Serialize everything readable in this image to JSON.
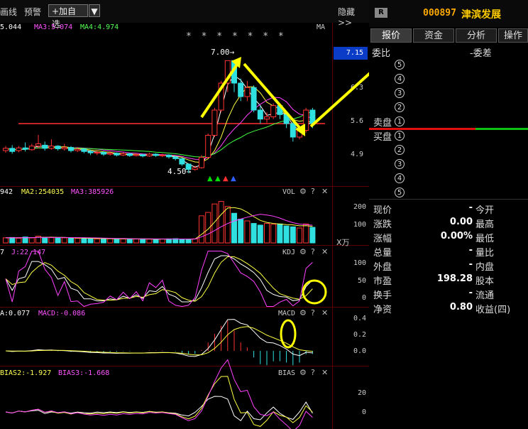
{
  "toolbar": {
    "chart_tab": "画线",
    "alert_tab": "预警",
    "add_favorite": "+加自选",
    "hide_label": "隐藏>>"
  },
  "main": {
    "ma_labels": [
      "5.044",
      "MA3:5.074",
      "MA4:4.974"
    ],
    "ma_tag": "MA",
    "price_ticks": [
      "7.15",
      "6.3",
      "5.6",
      "4.9"
    ],
    "high_label": "7.00→",
    "low_label": "4.50→",
    "stars": "* *  * * *    * *"
  },
  "vol": {
    "labels": [
      "942",
      "MA2:254035",
      "MA3:385926"
    ],
    "name": "VOL",
    "ticks": [
      "200",
      "100"
    ],
    "unit": "X万"
  },
  "kdj": {
    "labels": [
      "7",
      "J:22.147"
    ],
    "name": "KDJ",
    "ticks": [
      "100",
      "50",
      "0"
    ]
  },
  "macd": {
    "labels": [
      "A:0.077",
      "MACD:-0.086"
    ],
    "name": "MACD",
    "ticks": [
      "0.4",
      "0.2",
      "0.0"
    ]
  },
  "bias": {
    "labels": [
      "BIAS2:-1.927",
      "BIAS3:-1.668"
    ],
    "name": "BIAS",
    "ticks": [
      "20",
      "0"
    ]
  },
  "panel": {
    "badge": "R",
    "code": "000897",
    "name": "津滨发展",
    "tabs": [
      "报价",
      "资金",
      "分析",
      "操作"
    ],
    "bid_ratio": "委比",
    "bid_diff": "-委差",
    "sell_label": "卖盘",
    "buy_label": "买盘",
    "levels": [
      "5",
      "4",
      "3",
      "2",
      "1"
    ],
    "buy_levels": [
      "1",
      "2",
      "3",
      "4",
      "5"
    ],
    "stats": [
      {
        "l1": "现价",
        "v1": "-",
        "l2": "今开"
      },
      {
        "l1": "涨跌",
        "v1": "0.00",
        "l2": "最高"
      },
      {
        "l1": "涨幅",
        "v1": "0.00%",
        "l2": "最低"
      },
      {
        "l1": "总量",
        "v1": "-",
        "l2": "量比"
      },
      {
        "l1": "外盘",
        "v1": "-",
        "l2": "内盘"
      },
      {
        "l1": "市盈",
        "v1": "198.28",
        "l2": "股本"
      },
      {
        "l1": "换手",
        "v1": "-",
        "l2": "流通"
      },
      {
        "l1": "净资",
        "v1": "0.80",
        "l2": "收益(四)"
      }
    ]
  },
  "chart_data": {
    "type": "line",
    "title": "",
    "candles": [
      [
        5.0,
        5.05,
        5.1,
        4.95
      ],
      [
        5.05,
        4.98,
        5.12,
        4.93
      ],
      [
        5.0,
        5.06,
        5.1,
        4.96
      ],
      [
        5.06,
        5.03,
        5.18,
        4.98
      ],
      [
        5.02,
        5.1,
        5.15,
        5.0
      ],
      [
        5.1,
        5.15,
        5.35,
        5.05
      ],
      [
        5.12,
        5.05,
        5.2,
        5.0
      ],
      [
        5.05,
        5.1,
        5.25,
        5.02
      ],
      [
        5.1,
        5.04,
        5.12,
        5.0
      ],
      [
        5.04,
        5.07,
        5.15,
        5.0
      ],
      [
        5.07,
        5.0,
        5.1,
        4.96
      ],
      [
        5.0,
        5.03,
        5.08,
        4.97
      ],
      [
        5.03,
        4.98,
        5.06,
        4.94
      ],
      [
        4.98,
        4.95,
        5.02,
        4.9
      ],
      [
        4.95,
        4.96,
        5.0,
        4.9
      ],
      [
        4.96,
        4.92,
        4.99,
        4.88
      ],
      [
        4.92,
        4.94,
        4.98,
        4.89
      ],
      [
        4.94,
        4.9,
        4.96,
        4.87
      ],
      [
        4.9,
        4.93,
        4.96,
        4.88
      ],
      [
        4.93,
        4.89,
        4.95,
        4.86
      ],
      [
        4.89,
        4.91,
        4.94,
        4.87
      ],
      [
        4.91,
        4.88,
        4.93,
        4.85
      ],
      [
        4.88,
        4.92,
        4.95,
        4.86
      ],
      [
        4.92,
        4.89,
        4.94,
        4.86
      ],
      [
        4.89,
        4.9,
        4.93,
        4.86
      ],
      [
        4.9,
        4.86,
        4.92,
        4.82
      ],
      [
        4.86,
        4.82,
        4.88,
        4.78
      ],
      [
        4.82,
        4.7,
        4.84,
        4.66
      ],
      [
        4.7,
        4.58,
        4.72,
        4.5
      ],
      [
        4.58,
        4.62,
        4.66,
        4.55
      ],
      [
        4.62,
        4.85,
        4.9,
        4.6
      ],
      [
        4.85,
        5.34,
        5.38,
        4.84
      ],
      [
        5.34,
        5.9,
        5.95,
        5.3
      ],
      [
        5.9,
        6.5,
        6.55,
        5.85
      ],
      [
        6.5,
        7.0,
        7.0,
        6.3
      ],
      [
        7.0,
        6.5,
        7.0,
        6.3
      ],
      [
        6.5,
        6.2,
        6.6,
        6.1
      ],
      [
        6.2,
        6.4,
        6.55,
        6.1
      ],
      [
        6.4,
        5.9,
        6.45,
        5.85
      ],
      [
        5.9,
        5.7,
        6.0,
        5.6
      ],
      [
        5.7,
        5.75,
        5.85,
        5.62
      ],
      [
        5.75,
        6.0,
        6.05,
        5.7
      ],
      [
        6.0,
        5.8,
        6.05,
        5.7
      ],
      [
        5.8,
        5.6,
        5.85,
        5.5
      ],
      [
        5.6,
        5.3,
        5.65,
        5.2
      ],
      [
        5.3,
        5.45,
        5.55,
        5.25
      ],
      [
        5.45,
        5.9,
        5.95,
        5.4
      ],
      [
        5.9,
        5.6,
        5.95,
        5.5
      ]
    ],
    "volumes": [
      30,
      32,
      28,
      35,
      30,
      40,
      33,
      31,
      29,
      30,
      28,
      27,
      26,
      25,
      24,
      26,
      25,
      23,
      24,
      22,
      23,
      24,
      22,
      21,
      23,
      24,
      25,
      22,
      20,
      24,
      160,
      180,
      230,
      245,
      215,
      175,
      140,
      130,
      115,
      105,
      115,
      110,
      112,
      100,
      95,
      88,
      112,
      92
    ],
    "price_range": [
      4.4,
      7.4
    ],
    "vol_range": [
      0,
      260
    ],
    "support_level": 5.6
  }
}
